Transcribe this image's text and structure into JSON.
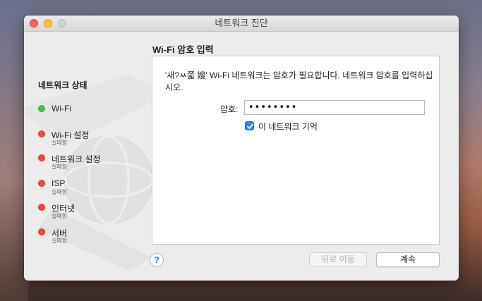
{
  "window": {
    "title": "네트워크 진단"
  },
  "sidebar": {
    "title": "네트워크 상태",
    "steps": [
      {
        "label": "Wi-Fi",
        "status_color": "#4cc14f",
        "sub": ""
      },
      {
        "label": "Wi-Fi 설정",
        "status_color": "#f1473f",
        "sub": "실패함"
      },
      {
        "label": "네트워크 설정",
        "status_color": "#f1473f",
        "sub": "실패함"
      },
      {
        "label": "ISP",
        "status_color": "#f1473f",
        "sub": "실패함"
      },
      {
        "label": "인터넷",
        "status_color": "#f1473f",
        "sub": "실패함"
      },
      {
        "label": "서버",
        "status_color": "#f1473f",
        "sub": "실패함"
      }
    ]
  },
  "main": {
    "title": "Wi-Fi 암호 입력",
    "message": "'새?ㅆ쭓 嫂' Wi-Fi 네트워크는 암호가 필요합니다. 네트워크 암호를 입력하십시오.",
    "password_label": "암호:",
    "password_value": "••••••••",
    "remember_label": "이 네트워크 기억",
    "remember_checked": true
  },
  "buttons": {
    "help": "?",
    "back": "뒤로 이동",
    "continue": "계속"
  },
  "icons": {
    "help": "help-icon",
    "checkmark": "checkmark-icon",
    "watermark": "network-diagnostics-globe-icon"
  },
  "colors": {
    "accent": "#2f82f6",
    "success": "#4cc14f",
    "failure": "#f1473f"
  }
}
